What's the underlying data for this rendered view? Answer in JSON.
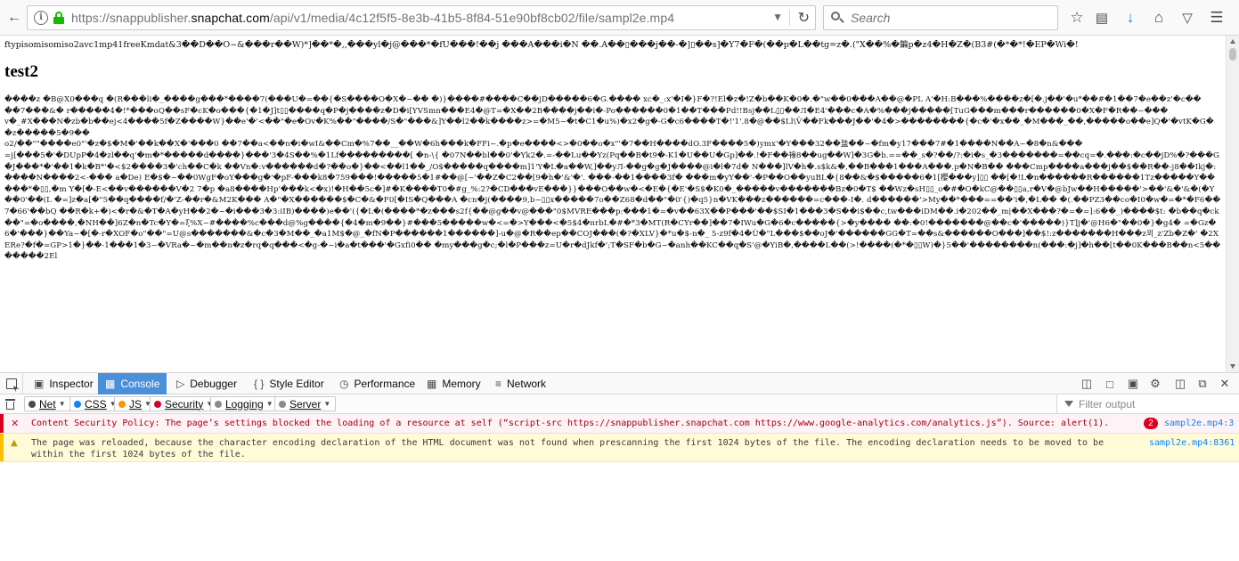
{
  "browser": {
    "url_prefix": "https://snappublisher.",
    "url_host": "snapchat.com",
    "url_path": "/api/v1/media/4c12f5f5-8e3b-41b5-8f84-51e90bf8cb02/file/sampl2e.mp4",
    "search_placeholder": "Search",
    "icons": [
      "back-arrow-icon",
      "info-icon",
      "lock-icon",
      "reload-icon",
      "search-icon",
      "star-icon",
      "reading-list-icon",
      "download-icon",
      "home-icon",
      "pocket-icon",
      "menu-icon"
    ],
    "colors": {
      "lock": "#12bc00",
      "download": "#0a84ff"
    }
  },
  "page": {
    "garbage_header": "ftypisomisomiso2avc1mp41freeKmdat&3��D��O~&���r��W)*]��*�,,���yl�j@���*�fU���!��j ���A���i�N ��.A��▯���j��-�]▯��s]�Y7�F�(��p�L��tg=z�.(\"X��%�鍽p�z4�H�Z�(B3#(�*�*!�EP�Wi�!",
    "heading": "test2",
    "garbage_lines": [
      "����z �B@X0���q �(R���li�_����g���*����7(���U�=��{�S����O�X�~�� �)}����#����C��jD�����6�G.���� xc�_:x'�I�}F�?!El�z�!Z�b��K�0�.�\"w��0���A��@�PL A'�H:B���%����z�[�.j��'�u*��#�1��7�e��z'�c��",
      "��7���&� r�����4�!*���oQ��sF�cK�o���{�1�J]t▯▯����q�P�j����z�D�i[YVSmn���E4�@T=�X��2B����j��i�-Po������0�1��T���Pd!!Bsj��L▯▯��Л�E4'���c�A�%���j�����[TuG���m���r������0�X�F�R��~���",
      "v�_#X���N�zb�b��ej<4����5f�Z����W}��e'�'<��\"�e�Ov�K%��\"����/S�\"���&]Y��l2��k����z>=�M5~�t�C1�u%)�x2�g�-G�c6����T�!'1'.8�@��$Ll\\Ѷ��Fk���J��'�4�>��������{�c�'�x��_�M���_��,�����o��e]Q�'�vtK�G��z�����5�9��",
      "o2/��\"\"����e0\"'�z�$�M�'��k��X�'���0 ��7��a<��n�i�wI&��Cm�%7��__��W�6h���k�FFi~.�p�e����<>�0��o�x\"'�7��H����dO.3F����5�)ymx'�Y���32��䀅��~�fm�y17���7#�1����N��A~�8�n&���"
    ],
    "garbage_tail": "=j[���5�'�DUpP�4�zl��q'�m�*�����d����}���'3�4S��%�1Lf���������[ �n-\\{ �07N��bl��0'�Yk2�.=-��Lu��Yz(Pq��B�t9�-K1�U��U�Gp]��.!�F��祿8��ug��W]�3G�b.==��_s�?��/?:�i�s_�3�������=��cq=�.���:�c��jD%�?���G�J���*�'��1�k�B*'�<$2����3�'ch��C�k ��Vn�:v������d�?��o�}��<��l1��_/O$�����q����m]1'Y�L�a��W,]��yЛ-��g�g�J����@i�l�7d� N���]lV�h�.s$k&�,��B���1���A���.p�N�B�� ���Cmp����a���j��$��R��-j8��Ikj�:����N����2<-��� a�De) E�$�~��0WgF�oY���g�'�pF-���k8�759���!�����5�1#��@[~'��Z�C2��[9�h�'&'�'. ���-��1����3f� ���m�yY��'-�P��O��yuBL�{8��&�$�����6�1[櫻���y]▯▯ ��[�!L�n������R������1Tz�����Y�����*�▯▯,�m Y�[�-E<��v������V�2 7�p �a8����Hp'���k<�x)!�H��5c�]#�K����T0�#g_%:2?�CD���vE���}}���O��w�<�E�{�E'�S$�K0�_�����v�������Bz�0�T$ ��Wz�sH▯▯_o�#�O�kC@��▯▯a,r�V�@bJw��H�����'>��'&�'&�(�Y��0'��(L �=]z�a[�\"5��q����f/�'Z-��r�&M2K��� A�\"�X������$�C�&�F0[�IS�Q���A �cn�j(����9,b~▯▯x�����7o��Z68�d��\"�0'{)�q5}n�VK���z������=c���-I�. d������'>My��*���==��'i�,�L�� �(.��PZ3��co�I0�w�=�*�F6��7�66'��bQ ��R�k+�)<�r�&�T�A�yH��2�~�i���3�3:iIB)����)e��'({�L�(����*�z���s2f{��@g��v@���\"0$MVRE���p:���1�=�v��63X��P���'��$SI�1���3�S��i$��c,tw���iDM��.i�202��_m|��X���?�=�=]:6��_)����$t: �b��q�ck��\"=�o����,�NH��]6Z�n�Tc�Y�=ξ%X~#����%c���d@%g����{�4�m�9��}#���5�����w�<=�>Y���<�5$4�nrbL�#�*3�MT(R�CYr��]��7�IWu�G�6�c�����{>�y���� ��:�0!�������@��c�'�����)}T]j�'@H6�\"��0�}�g4� =�Gz�6�'���}��Ya~�[�-r�XOF�o\"��\"=U@s�������&�c�3�M��_�a1M$�@_�fN�P������1������]-u�@�R��ep��COJ���(�?�XLV}�*u�$-n�_ 5-z9f�4�Ù�\"L���$��oJ�'������GG�T=��s&������O���]��$!:z�������H���z꾀_z'Zb�Z�' �2XERe?�f�=GP>1�}��-1���1�3~�VRa�~�m��n�z�rq�q���<�g-�~i�a�t���'�Gxfi0�� �my���g�c;�l�P���z=U�r�dJkf�';T�SF�b�G~�anh��KC��q�S'@�YiB�,����L��(>!����(�*�▯▯W)�}5��'��������n(���:�j]�h��[t��0K���B��n<5�������2El"
  },
  "devtools": {
    "tabs": [
      {
        "label": "Inspector",
        "icon": "inspector-icon"
      },
      {
        "label": "Console",
        "icon": "console-icon",
        "active": true
      },
      {
        "label": "Debugger",
        "icon": "debugger-icon"
      },
      {
        "label": "Style Editor",
        "icon": "style-editor-icon"
      },
      {
        "label": "Performance",
        "icon": "performance-icon"
      },
      {
        "label": "Memory",
        "icon": "memory-icon"
      },
      {
        "label": "Network",
        "icon": "network-icon"
      }
    ],
    "filters": [
      {
        "label": "Net",
        "color": "#4a4a4f"
      },
      {
        "label": "CSS",
        "color": "#0a84ff"
      },
      {
        "label": "JS",
        "color": "#ff9400"
      },
      {
        "label": "Security",
        "color": "#d70022"
      },
      {
        "label": "Logging",
        "color": "#8a8a8f"
      },
      {
        "label": "Server",
        "color": "#8a8a8f"
      }
    ],
    "filter_placeholder": "Filter output",
    "messages": [
      {
        "type": "error",
        "text": "Content Security Policy: The page’s settings blocked the loading of a resource at self (“script-src https://snappublisher.snapchat.com https://www.google-analytics.com/analytics.js”). Source: alert(1).",
        "count": "2",
        "source": "sampl2e.mp4:3"
      },
      {
        "type": "warning",
        "text": "The page was reloaded, because the character encoding declaration of the HTML document was not found when prescanning the first 1024 bytes of the file. The encoding declaration needs to be moved to be within the first 1024 bytes of the file.",
        "source": "sampl2e.mp4:8361"
      }
    ],
    "colors": {
      "active_tab": "#4a90d9",
      "error": "#d70022",
      "warning": "#ffbf00"
    }
  }
}
